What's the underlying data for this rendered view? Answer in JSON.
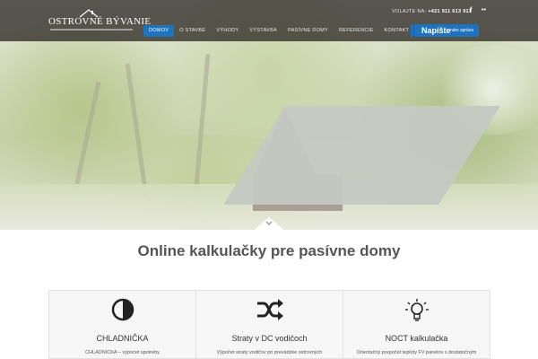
{
  "header": {
    "logo_text": "OSTROVNÉ BÝVANIE",
    "phone_label": "VOLAJTE NA:",
    "phone_number": "+421 911 613 911",
    "social": [
      {
        "icon": "facebook-icon",
        "glyph": "f"
      },
      {
        "icon": "flickr-icon",
        "glyph": "••"
      }
    ],
    "nav": [
      {
        "label": "DOMOV",
        "active": true
      },
      {
        "label": "O STAVBE",
        "active": false
      },
      {
        "label": "VÝHODY",
        "active": false
      },
      {
        "label": "VÝSTAVBA",
        "active": false
      },
      {
        "label": "PASÍVNE DOMY",
        "active": false
      },
      {
        "label": "REFERENCIE",
        "active": false
      },
      {
        "label": "KONTAKT",
        "active": false
      }
    ],
    "cta_main": "Napíšte",
    "cta_sub": "nám správu"
  },
  "hero": {
    "scroll_icon": "chevron-down-icon"
  },
  "main": {
    "title": "Online kalkulačky pre pasívne domy",
    "cards": [
      {
        "icon": "half-circle-icon",
        "title": "CHLADNIČKA",
        "text": "CHLADNIČKA – výpočet spotreby"
      },
      {
        "icon": "shuffle-icon",
        "title": "Straty v DC vodičoch",
        "text": "Výpočet straty vodičov pri prevádzke ostrovných"
      },
      {
        "icon": "lightbulb-icon",
        "title": "NOCT kalkulačka",
        "text": "Orientačný prepočet teploty FV panelov s dostatočným"
      }
    ]
  },
  "colors": {
    "accent": "#1e73be",
    "topbar": "#302c28",
    "title_text": "#555555"
  }
}
